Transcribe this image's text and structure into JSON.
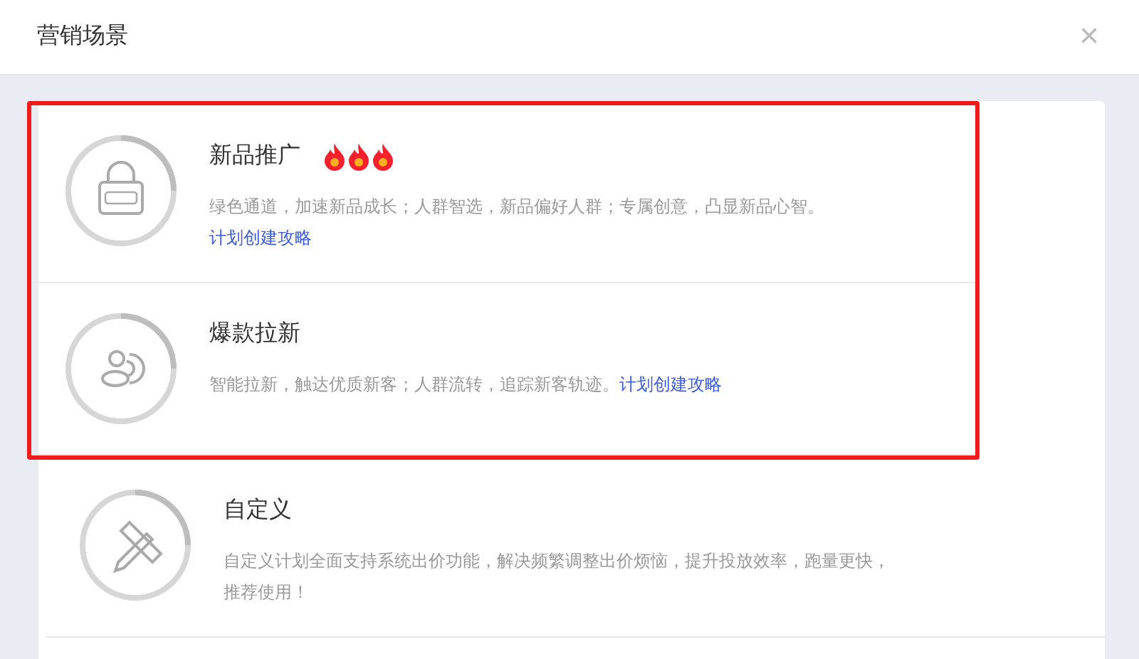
{
  "dialog": {
    "title": "营销场景",
    "close": "×"
  },
  "scenes": [
    {
      "kind": "new-bag",
      "title": "新品推广",
      "hot": true,
      "highlighted": true,
      "description": "绿色通道，加速新品成长；人群智选，新品偏好人群；专属创意，凸显新品心智。",
      "link": "计划创建攻略"
    },
    {
      "kind": "people",
      "title": "爆款拉新",
      "hot": false,
      "highlighted": true,
      "description": "智能拉新，触达优质新客；人群流转，追踪新客轨迹。",
      "link": "计划创建攻略"
    },
    {
      "kind": "tools",
      "title": "自定义",
      "hot": false,
      "highlighted": false,
      "description": "自定义计划全面支持系统出价功能，解决频繁调整出价烦恼，提升投放效率，跑量更快，推荐使用！"
    }
  ]
}
